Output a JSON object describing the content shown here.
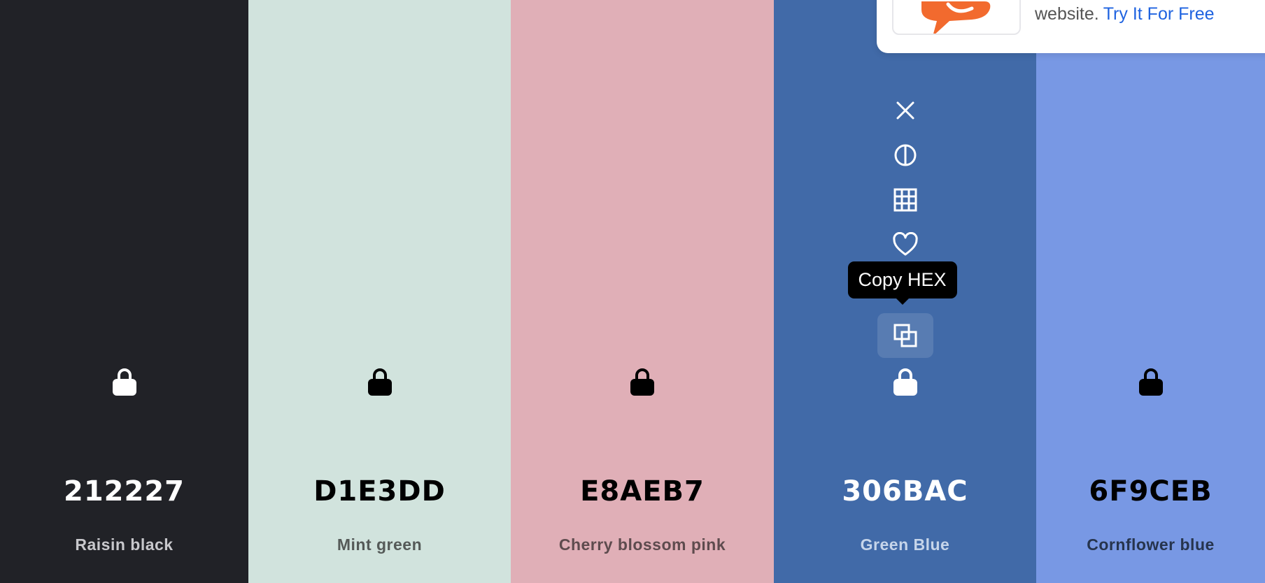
{
  "palette": {
    "colors": [
      {
        "hex": "212227",
        "name": "Raisin black",
        "bg": "#212227",
        "fg": "#ffffff",
        "sub": "#c8c8cc",
        "lock": "#ffffff"
      },
      {
        "hex": "D1E3DD",
        "name": "Mint green",
        "bg": "#D1E3DD",
        "fg": "#000000",
        "sub": "#555a58",
        "lock": "#000000"
      },
      {
        "hex": "E8AEB7",
        "name": "Cherry blossom pink",
        "bg": "#E0AFB7",
        "fg": "#000000",
        "sub": "#5e4b4e",
        "lock": "#000000"
      },
      {
        "hex": "306BAC",
        "name": "Green Blue",
        "bg": "#416AA8",
        "fg": "#ffffff",
        "sub": "#c6d5ea",
        "lock": "#ffffff"
      },
      {
        "hex": "6F9CEB",
        "name": "Cornflower blue",
        "bg": "#7898E4",
        "fg": "#000000",
        "sub": "#26344d",
        "lock": "#000000"
      }
    ]
  },
  "tooltip": {
    "label": "Copy HEX"
  },
  "tools": {
    "icons": [
      "close-icon",
      "contrast-icon",
      "grid-icon",
      "heart-icon",
      "copy-icon"
    ]
  },
  "popup": {
    "text": "website.",
    "link": "Try It For Free",
    "accent": "#f26a2e"
  }
}
